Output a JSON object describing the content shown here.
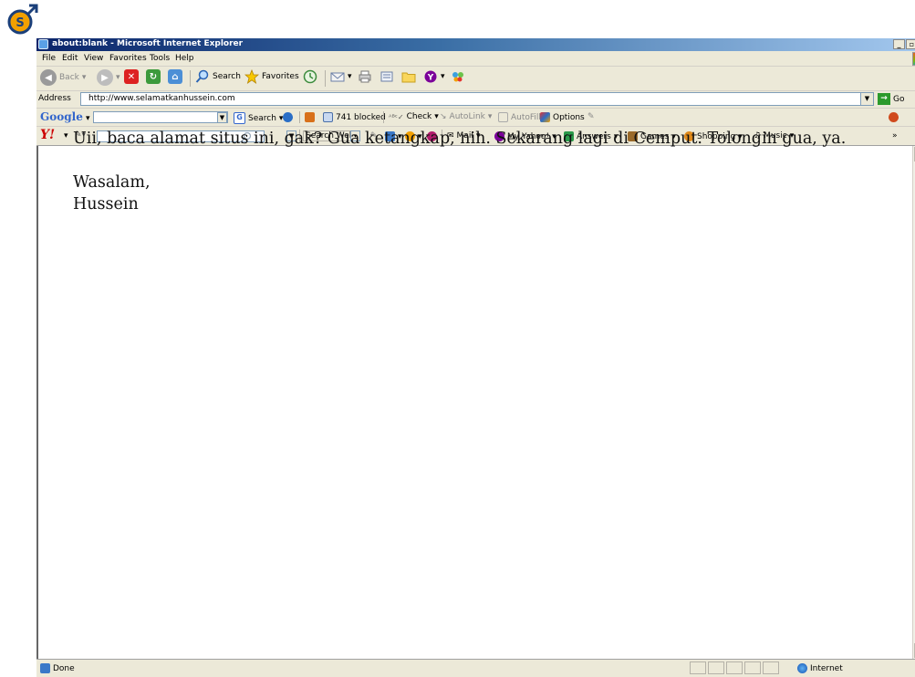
{
  "window": {
    "title": "about:blank - Microsoft Internet Explorer"
  },
  "menu": {
    "items": [
      "File",
      "Edit",
      "View",
      "Favorites",
      "Tools",
      "Help"
    ]
  },
  "toolbar": {
    "back_label": "Back",
    "search_label": "Search",
    "favorites_label": "Favorites"
  },
  "address": {
    "label": "Address",
    "url": "http://www.selamatkanhussein.com",
    "go_label": "Go"
  },
  "google_bar": {
    "logo": "Google",
    "search_label": "Search",
    "blocked_label": "741 blocked",
    "check_label": "Check",
    "autolink_label": "AutoLink",
    "autofill_label": "AutoFill",
    "options_label": "Options"
  },
  "yahoo_bar": {
    "logo": "Y!",
    "search_web_label": "Search Web",
    "mail_label": "Mail",
    "my_yahoo_label": "My Yahoo!",
    "answers_label": "Answers",
    "games_label": "Games",
    "shopping_label": "Shopping",
    "music_label": "Music",
    "more_label": "»"
  },
  "page": {
    "line1": "Uii, baca alamat situs ini, gak? Gua ketangkap, nih. Sekarang lagi di Cemput. Tolongin gua, ya.",
    "line2": "Wasalam,",
    "line3": "Hussein"
  },
  "status": {
    "text": "Done",
    "zone": "Internet"
  },
  "colors": {
    "title_bar_start": "#0a246a",
    "title_bar_end": "#a6caf0",
    "chrome": "#ece9d8"
  }
}
